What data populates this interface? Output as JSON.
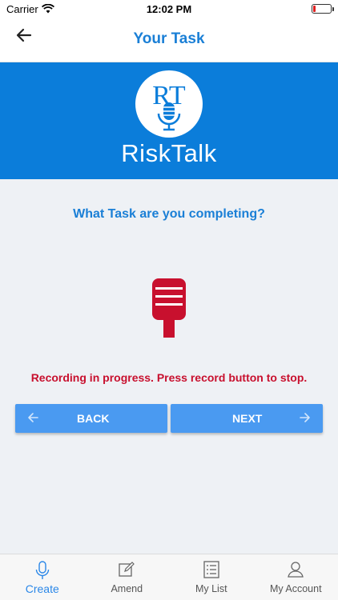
{
  "status_bar": {
    "carrier": "Carrier",
    "time": "12:02 PM",
    "battery_level_percent": 12
  },
  "nav": {
    "title": "Your Task",
    "back_icon": "arrow-left-icon"
  },
  "banner": {
    "logo_monogram": "RT",
    "logo_text": "RiskTalk",
    "background_color": "#0b7dda"
  },
  "main": {
    "question": "What Task are you completing?",
    "mic_icon": "microphone-icon",
    "mic_color": "#c8102e",
    "recording_message": "Recording in progress. Press record button to stop."
  },
  "buttons": {
    "back_label": "BACK",
    "next_label": "NEXT",
    "color": "#4a9af1"
  },
  "tab_bar": {
    "active_color": "#2a87e8",
    "tabs": [
      {
        "label": "Create",
        "icon": "microphone-icon",
        "active": true
      },
      {
        "label": "Amend",
        "icon": "edit-icon",
        "active": false
      },
      {
        "label": "My List",
        "icon": "list-icon",
        "active": false
      },
      {
        "label": "My Account",
        "icon": "user-icon",
        "active": false
      }
    ]
  }
}
